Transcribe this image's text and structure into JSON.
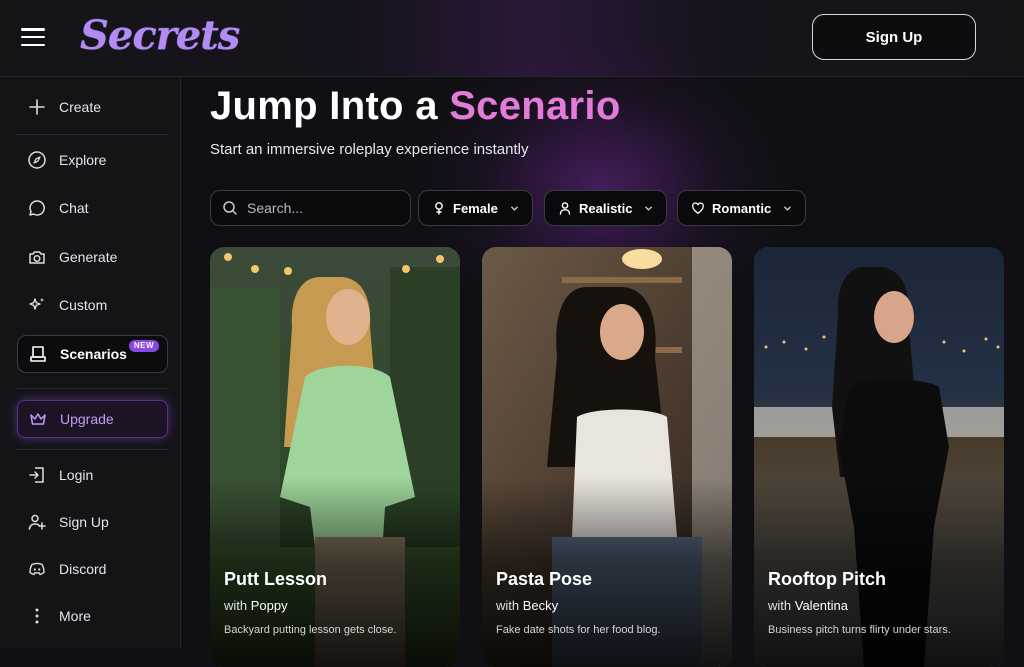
{
  "brand": {
    "logo_text": "Secrets",
    "logo_color": "#b28cf0"
  },
  "header": {
    "signup_label": "Sign Up"
  },
  "sidebar": {
    "items": [
      {
        "label": "Create",
        "icon": "plus-icon"
      },
      {
        "label": "Explore",
        "icon": "compass-icon"
      },
      {
        "label": "Chat",
        "icon": "chat-bubble-icon"
      },
      {
        "label": "Generate",
        "icon": "camera-icon"
      },
      {
        "label": "Custom",
        "icon": "sparkles-icon"
      },
      {
        "label": "Scenarios",
        "icon": "scenario-icon",
        "badge": "NEW",
        "active": true
      },
      {
        "label": "Upgrade",
        "icon": "crown-icon"
      },
      {
        "label": "Login",
        "icon": "login-icon"
      },
      {
        "label": "Sign Up",
        "icon": "user-plus-icon"
      },
      {
        "label": "Discord",
        "icon": "discord-icon"
      },
      {
        "label": "More",
        "icon": "more-vertical-icon"
      }
    ]
  },
  "main": {
    "heading_prefix": "Jump Into a",
    "heading_accent": "Scenario",
    "subheading": "Start an immersive roleplay experience instantly",
    "search": {
      "placeholder": "Search..."
    },
    "filters": [
      {
        "label": "Female",
        "icon": "female-icon"
      },
      {
        "label": "Realistic",
        "icon": "person-icon"
      },
      {
        "label": "Romantic",
        "icon": "heart-icon"
      }
    ],
    "cards": [
      {
        "title": "Putt Lesson",
        "with_prefix": "with",
        "character": "Poppy",
        "description": "Backyard putting lesson gets close."
      },
      {
        "title": "Pasta Pose",
        "with_prefix": "with",
        "character": "Becky",
        "description": "Fake date shots for her food blog."
      },
      {
        "title": "Rooftop Pitch",
        "with_prefix": "with",
        "character": "Valentina",
        "description": "Business pitch turns flirty under stars."
      }
    ]
  },
  "colors": {
    "accent_pink": "#e37bd8",
    "accent_purple": "#8a47e6",
    "background": "#101014"
  }
}
